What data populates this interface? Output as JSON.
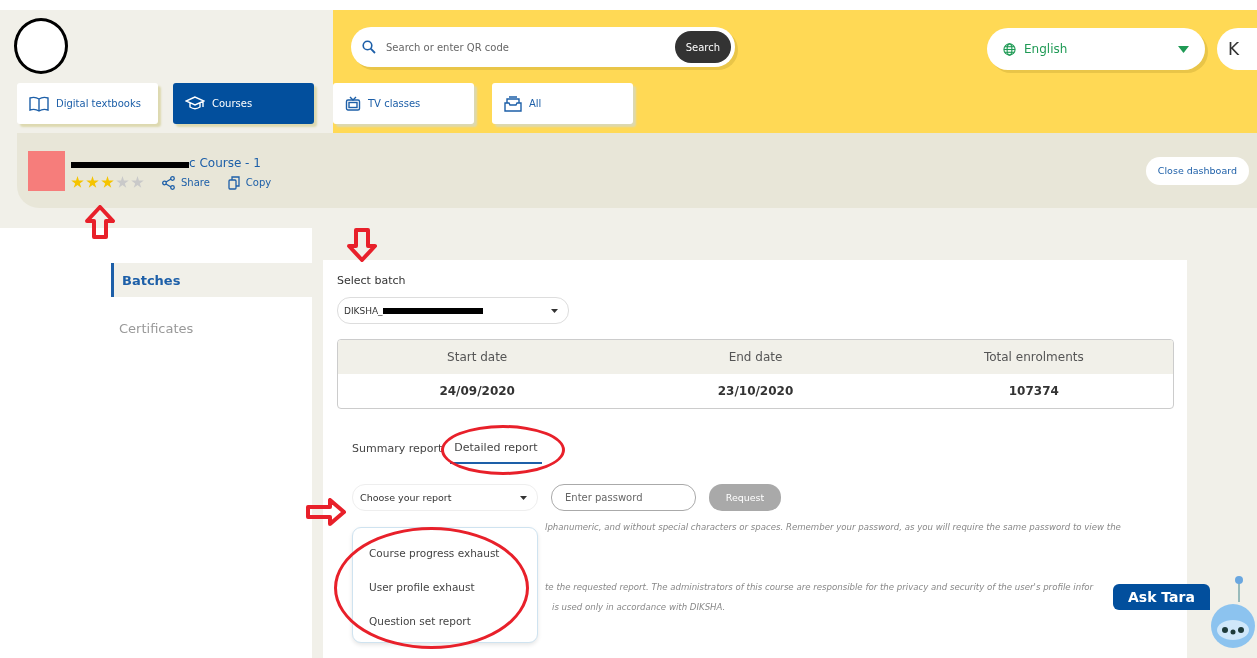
{
  "header": {
    "search": {
      "placeholder": "Search or enter QR code",
      "button": "Search"
    },
    "language": "English",
    "profile_initial": "K"
  },
  "nav_tabs": [
    {
      "label": "Digital textbooks",
      "kind": "book",
      "selected": false
    },
    {
      "label": "Courses",
      "kind": "cap",
      "selected": true
    },
    {
      "label": "TV classes",
      "kind": "tv",
      "selected": false
    },
    {
      "label": "All",
      "kind": "tray",
      "selected": false
    }
  ],
  "course": {
    "title_visible": "c Course - 1",
    "stars": 3,
    "share": "Share",
    "copy": "Copy",
    "close": "Close dashboard"
  },
  "sidebar": [
    {
      "label": "Batches",
      "selected": true
    },
    {
      "label": "Certificates",
      "selected": false
    }
  ],
  "batch": {
    "label": "Select batch",
    "value_visible": "DIKSHA_"
  },
  "summary_table": {
    "columns": [
      "Start date",
      "End date",
      "Total enrolments"
    ],
    "values": [
      "24/09/2020",
      "23/10/2020",
      "107374"
    ]
  },
  "report_tabs": [
    {
      "label": "Summary report",
      "selected": false
    },
    {
      "label": "Detailed report",
      "selected": true
    }
  ],
  "report_form": {
    "report_select": "Choose your report",
    "password_placeholder": "Enter password",
    "request": "Request",
    "request_disabled": true,
    "options": [
      "Course progress exhaust",
      "User profile exhaust",
      "Question set report"
    ],
    "notes": [
      "lphanumeric, and without special characters or spaces. Remember your password, as you will require the same password to view the",
      "te the requested report. The administrators of this course are responsible for the privacy and security of the user's profile infor",
      "is used only in accordance with DIKSHA."
    ]
  },
  "chat": {
    "label": "Ask Tara"
  }
}
